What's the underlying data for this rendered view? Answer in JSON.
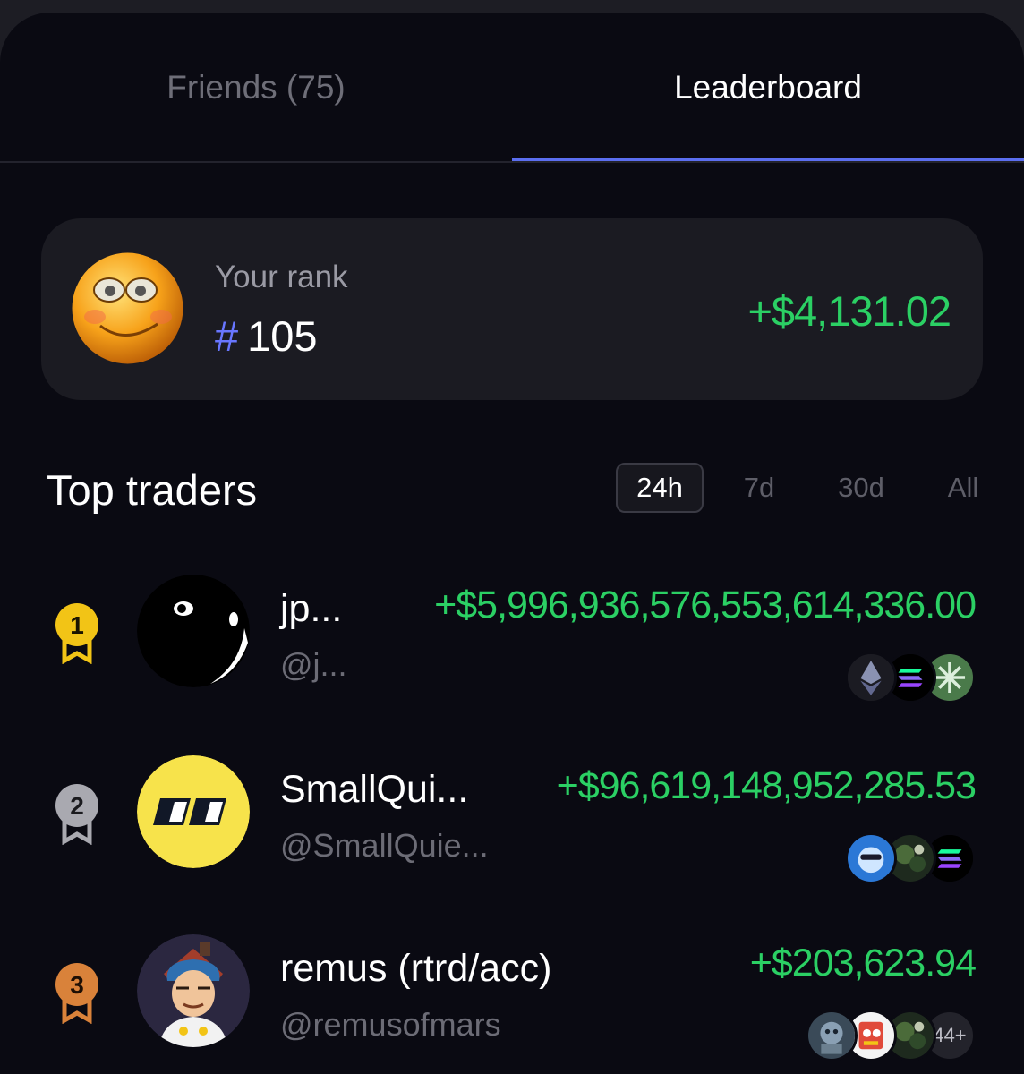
{
  "tabs": {
    "friends_label": "Friends (75)",
    "leaderboard_label": "Leaderboard"
  },
  "your_rank": {
    "label": "Your rank",
    "hash": "#",
    "rank": "105",
    "pnl": "+$4,131.02"
  },
  "top_traders": {
    "title": "Top traders",
    "periods": [
      "24h",
      "7d",
      "30d",
      "All"
    ],
    "active_period": "24h"
  },
  "traders": [
    {
      "rank": "1",
      "name": "jp...",
      "handle": "@j...",
      "pnl": "+$5,996,936,576,553,614,336.00",
      "tokens": [
        "ethereum-icon",
        "solana-icon",
        "green-token-icon"
      ]
    },
    {
      "rank": "2",
      "name": "SmallQui...",
      "handle": "@SmallQuie...",
      "pnl": "+$96,619,148,952,285.53",
      "tokens": [
        "blue-face-token-icon",
        "dark-token-icon",
        "solana-icon"
      ]
    },
    {
      "rank": "3",
      "name": "remus (rtrd/acc)",
      "handle": "@remusofmars",
      "pnl": "+$203,623.94",
      "tokens": [
        "robot-token-icon",
        "cartoon-token-icon",
        "dark-token-icon"
      ],
      "more": "44+"
    }
  ],
  "colors": {
    "accent": "#5b6ef0",
    "positive": "#2bd064",
    "gold": "#f2c416",
    "silver": "#a9a9b0",
    "bronze": "#d9823a"
  }
}
